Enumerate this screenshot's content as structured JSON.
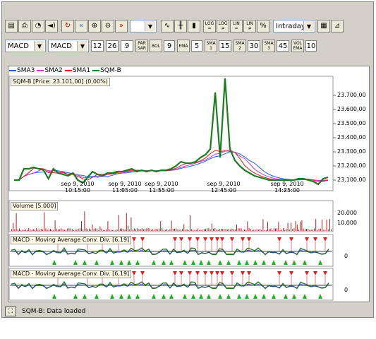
{
  "toolbar": {
    "icons": [
      "chart-window-icon",
      "print-icon",
      "timer-icon",
      "sound-icon",
      "refresh-icon",
      "rewind-icon",
      "zoom-in-icon",
      "zoom-out-icon",
      "fast-forward-icon"
    ],
    "style_icons": [
      "line-chart-icon",
      "bar-chart-icon",
      "candlestick-icon"
    ],
    "scale_buttons": [
      {
        "l1": "LOG",
        "l2": "="
      },
      {
        "l1": "LOG",
        "l2": "≠"
      },
      {
        "l1": "LIN",
        "l2": "="
      },
      {
        "l1": "LIN",
        "l2": "≠"
      },
      {
        "l1": "%",
        "l2": ""
      }
    ],
    "period": "Intraday",
    "empty_select": ""
  },
  "indicators_row": {
    "indicator1": "MACD",
    "indicator2": "MACD",
    "p1": "12",
    "p2": "26",
    "p3": "9",
    "parsar_label_1": "PAR",
    "parsar_label_2": "SAR",
    "bol_label": "BOL",
    "bol_value": "9",
    "ema_label": "EMA",
    "ema_value": "5",
    "sma1_label": "SMA",
    "sma1_sub": "1",
    "sma1_value": "15",
    "sma2_label": "SMA",
    "sma2_sub": "2",
    "sma2_value": "30",
    "sma3_label": "SMA",
    "sma3_sub": "3",
    "sma3_value": "45",
    "vol_label_1": "VOL",
    "vol_label_2": "EMA",
    "vol_value": "10"
  },
  "legend": [
    {
      "name": "SMA3",
      "color": "#1f5fd6"
    },
    {
      "name": "SMA2",
      "color": "#c040c0"
    },
    {
      "name": "SMA1",
      "color": "#d02020"
    },
    {
      "name": "SQM-B",
      "color": "#1e7a1e"
    }
  ],
  "price_panel_title": "SQM-B [Price: 23.101,00] (0,00%)",
  "volume_panel_title": "Volume [5.000]",
  "macd_panel_title_1": "MACD - Moving Average Conv. Div. [6,19]",
  "macd_panel_title_2": "MACD - Moving Average Conv. Div. [6,19]",
  "status_text": "SQM-B: Data loaded",
  "chart_data": {
    "type": "line",
    "series_name": "SQM-B",
    "y_ticks": [
      "23.700,00",
      "23.600,00",
      "23.500,00",
      "23.400,00",
      "23.300,00",
      "23.200,00",
      "23.100,00"
    ],
    "x_ticks": [
      {
        "d": "sep 9, 2010",
        "t": "10:15:00"
      },
      {
        "d": "sep 9, 2010",
        "t": "11:05:00"
      },
      {
        "d": "sep 9, 2010",
        "t": "11:55:00"
      },
      {
        "d": "sep 9, 2010",
        "t": "12:45:00"
      },
      {
        "d": "sep 9, 2010",
        "t": "14:25:00"
      }
    ],
    "volume_ticks": [
      "20.000",
      "10.000"
    ],
    "macd_zero": "0",
    "ylim": [
      23030,
      23830
    ],
    "price": [
      23100,
      23100,
      23180,
      23180,
      23190,
      23180,
      23170,
      23110,
      23180,
      23150,
      23140,
      23130,
      23150,
      23100,
      23080,
      23120,
      23160,
      23140,
      23130,
      23150,
      23150,
      23160,
      23160,
      23170,
      23180,
      23160,
      23170,
      23160,
      23170,
      23160,
      23170,
      23170,
      23180,
      23200,
      23230,
      23220,
      23220,
      23230,
      23260,
      23280,
      23320,
      23720,
      23260,
      23820,
      23320,
      23240,
      23200,
      23170,
      23150,
      23130,
      23120,
      23110,
      23100,
      23100,
      23100,
      23100,
      23100,
      23100,
      23110,
      23110,
      23100,
      23090,
      23070,
      23110,
      23120
    ]
  }
}
